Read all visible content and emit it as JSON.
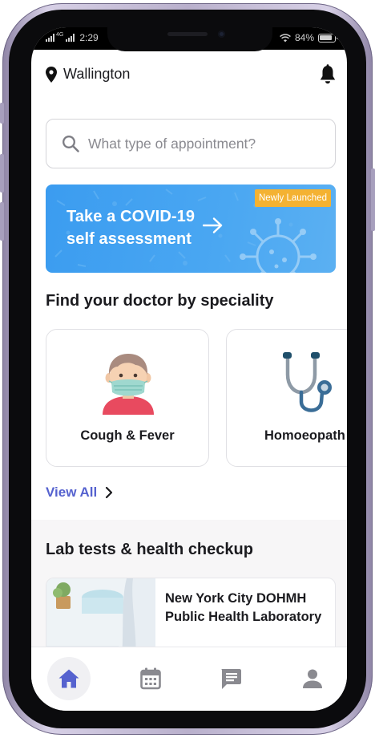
{
  "status_bar": {
    "time": "2:29",
    "network": "4G",
    "battery": "84%"
  },
  "header": {
    "location": "Wallington"
  },
  "search": {
    "placeholder": "What type of appointment?"
  },
  "banner": {
    "line1": "Take a COVID-19",
    "line2": "self assessment",
    "badge": "Newly Launched"
  },
  "speciality": {
    "title": "Find your doctor by speciality",
    "cards": [
      {
        "label": "Cough & Fever",
        "icon": "masked-person-icon"
      },
      {
        "label": "Homoeopath",
        "icon": "stethoscope-icon"
      }
    ],
    "view_all": "View All"
  },
  "lab": {
    "title": "Lab tests & health checkup",
    "card_name": "New York City DOHMH Public Health Laboratory"
  },
  "tab_bar": {
    "tabs": [
      {
        "icon": "home-icon",
        "active": true
      },
      {
        "icon": "calendar-icon",
        "active": false
      },
      {
        "icon": "chat-icon",
        "active": false
      },
      {
        "icon": "profile-icon",
        "active": false
      }
    ]
  },
  "colors": {
    "accent": "#5562CF",
    "banner": "#4AA7F2",
    "badge": "#F4B232",
    "text": "#1B1B1F"
  }
}
